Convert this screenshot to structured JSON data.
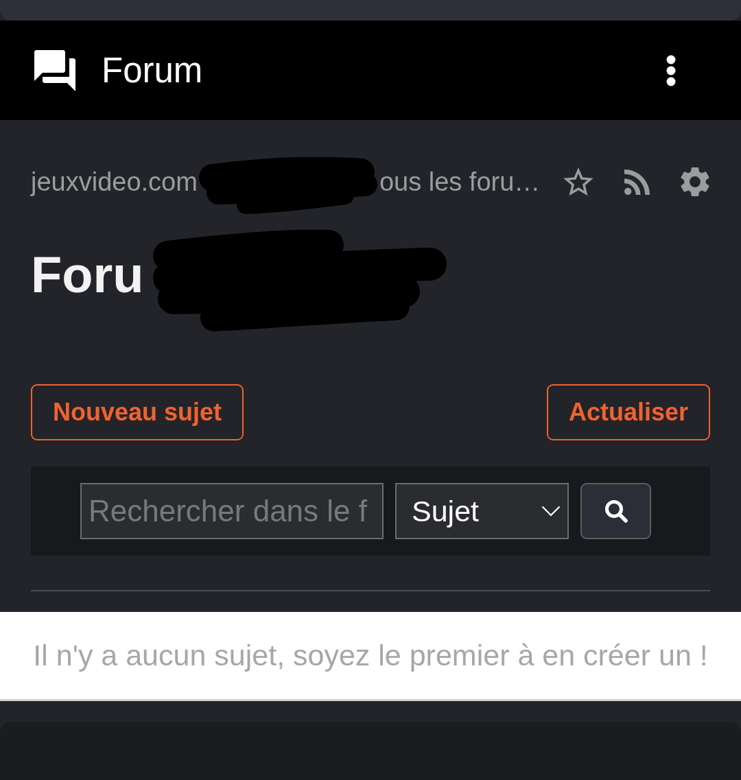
{
  "top_bar": {
    "title": "Forum"
  },
  "breadcrumb": {
    "texts": [
      "jeuxvideo.com",
      "ous les foru…"
    ]
  },
  "page_title": "Foru",
  "actions": [
    {
      "label": "Nouveau sujet"
    },
    {
      "label": "Actualiser"
    }
  ],
  "search": {
    "placeholder": "Rechercher dans le f",
    "scope": "Sujet"
  },
  "empty_message": "Il n'y a aucun sujet, soyez le premier à en créer un !"
}
